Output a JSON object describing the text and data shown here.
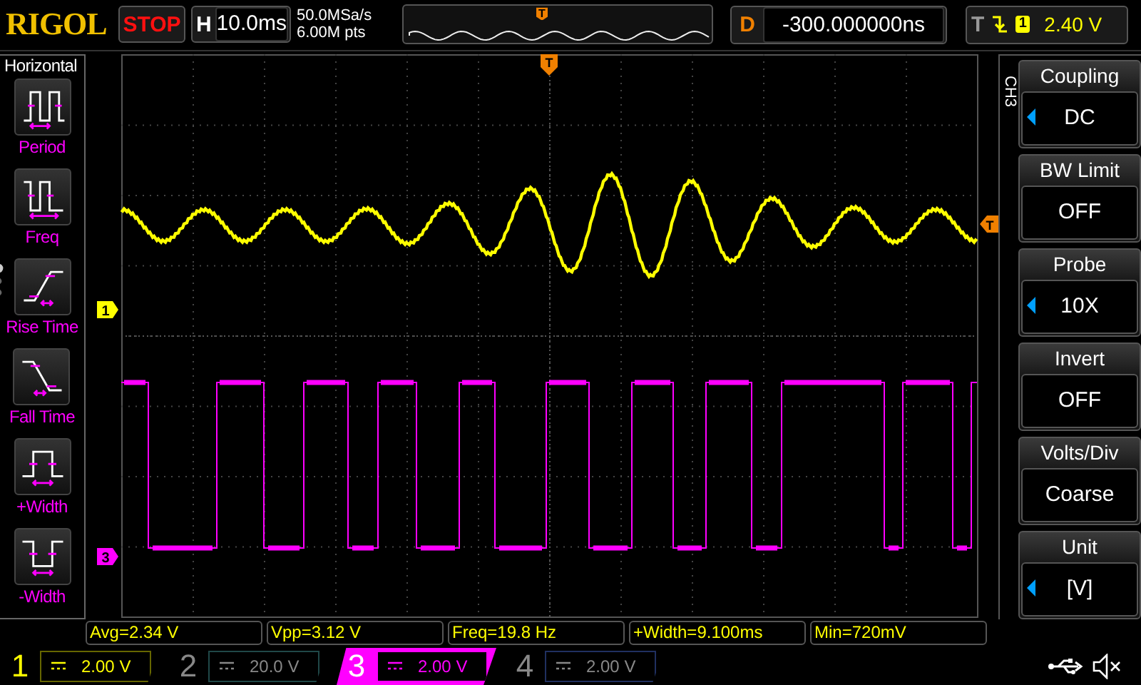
{
  "brand": "RIGOL",
  "run_state": "STOP",
  "timebase": {
    "label": "H",
    "value": "10.0ms"
  },
  "acquisition": {
    "sample_rate": "50.0MSa/s",
    "memory_depth": "6.00M pts"
  },
  "memory_bar": {
    "trigger_marker": "T"
  },
  "delay": {
    "label": "D",
    "value": "-300.000000ns"
  },
  "trigger": {
    "label": "T",
    "source": "1",
    "level": "2.40 V"
  },
  "left_menu": {
    "title": "Horizontal",
    "items": [
      {
        "kind": "period",
        "label": "Period"
      },
      {
        "kind": "freq",
        "label": "Freq"
      },
      {
        "kind": "rise",
        "label": "Rise Time"
      },
      {
        "kind": "fall",
        "label": "Fall Time"
      },
      {
        "kind": "pwidth",
        "label": "+Width"
      },
      {
        "kind": "nwidth",
        "label": "-Width"
      }
    ]
  },
  "scope": {
    "channel_markers": [
      {
        "label": "1",
        "color": "#ffff00"
      },
      {
        "label": "3",
        "color": "#ff00ff"
      }
    ],
    "trigger_position_marker": "T",
    "trigger_level_marker": "T"
  },
  "right_menu": {
    "channel": "CH3",
    "items": [
      {
        "title": "Coupling",
        "value": "DC",
        "adjustable": true
      },
      {
        "title": "BW Limit",
        "value": "OFF",
        "adjustable": false
      },
      {
        "title": "Probe",
        "value": "10X",
        "adjustable": true
      },
      {
        "title": "Invert",
        "value": "OFF",
        "adjustable": false
      },
      {
        "title": "Volts/Div",
        "value": "Coarse",
        "adjustable": false
      },
      {
        "title": "Unit",
        "value": "[V]",
        "adjustable": true
      }
    ]
  },
  "measurements": [
    "Avg=2.34 V",
    "Vpp=3.12 V",
    "Freq=19.8 Hz",
    "+Width=9.100ms",
    "Min=720mV"
  ],
  "channels": [
    {
      "number": "1",
      "scale": "2.00 V",
      "color": "#ffff00",
      "on": true,
      "selected": false
    },
    {
      "number": "2",
      "scale": "20.0 V",
      "color": "#204848",
      "on": false,
      "selected": false
    },
    {
      "number": "3",
      "scale": "2.00 V",
      "color": "#ff00ff",
      "on": true,
      "selected": true
    },
    {
      "number": "4",
      "scale": "2.00 V",
      "color": "#203060",
      "on": false,
      "selected": false
    }
  ]
}
